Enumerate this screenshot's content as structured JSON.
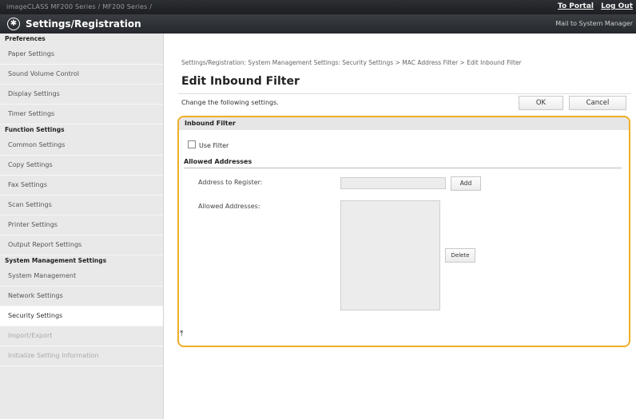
{
  "topbar": {
    "device": "imageCLASS   MF200 Series / MF200 Series /",
    "to_portal": "To Portal",
    "log_out": "Log Out"
  },
  "header": {
    "app_title": "Settings/Registration",
    "mail_link": "Mail to System Manager",
    "logo_icon": "gear-star-icon"
  },
  "sidebar": {
    "sections": [
      {
        "title": "Preferences",
        "items": [
          "Paper Settings",
          "Sound Volume Control",
          "Display Settings",
          "Timer Settings"
        ]
      },
      {
        "title": "Function Settings",
        "items": [
          "Common Settings",
          "Copy Settings",
          "Fax Settings",
          "Scan Settings",
          "Printer Settings",
          "Output Report Settings"
        ]
      },
      {
        "title": "System Management Settings",
        "items": [
          "System Management",
          "Network Settings",
          "Security Settings",
          "Import/Export",
          "Initialize Setting Information"
        ]
      }
    ]
  },
  "main": {
    "breadcrumb": "Settings/Registration: System Management Settings: Security Settings > MAC Address Filter > Edit Inbound Filter",
    "title": "Edit Inbound Filter",
    "description": "Change the following settings.",
    "ok_label": "OK",
    "cancel_label": "Cancel"
  },
  "panel": {
    "heading": "Inbound Filter",
    "use_filter_label": "Use Filter",
    "use_filter_checked": false,
    "allowed_heading": "Allowed Addresses",
    "address_label": "Address to Register:",
    "address_value": "",
    "add_label": "Add",
    "allowed_label": "Allowed Addresses:",
    "allowed_list": [],
    "delete_label": "Delete"
  },
  "footer": {
    "to_top_icon": "back-to-top-icon",
    "to_top_glyph": "⤒"
  },
  "colors": {
    "highlight": "#f0ad26",
    "topbar": "#1d1f22",
    "sidebar": "#e9e9e9"
  }
}
